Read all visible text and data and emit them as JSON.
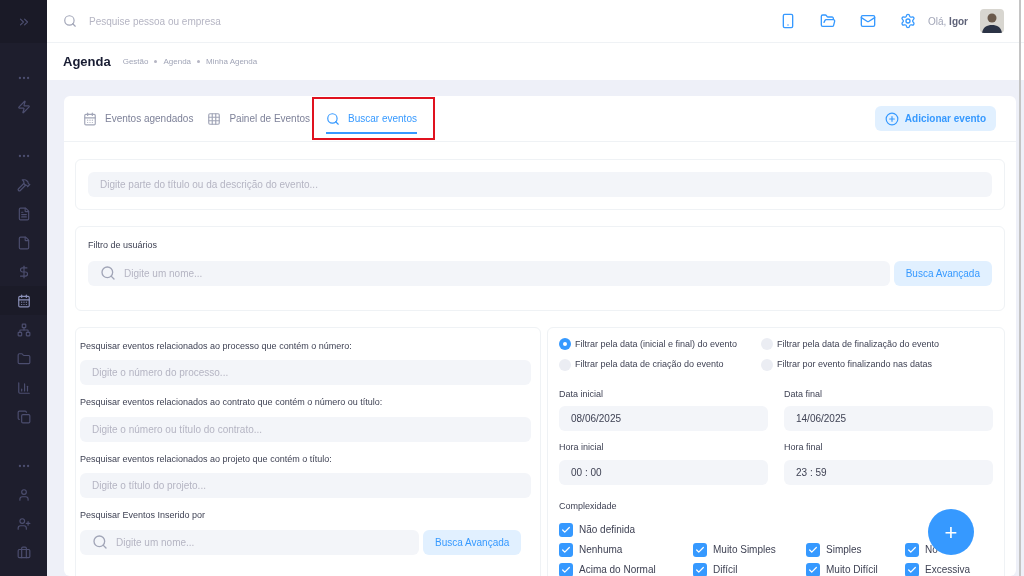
{
  "sidebar": {
    "items": [
      {
        "selected": false
      },
      {
        "selected": false
      },
      {
        "selected": false
      },
      {
        "selected": false
      },
      {
        "selected": false
      },
      {
        "selected": false
      },
      {
        "selected": false
      },
      {
        "selected": false
      },
      {
        "selected": true
      },
      {
        "selected": false
      },
      {
        "selected": false
      },
      {
        "selected": false
      },
      {
        "selected": false
      },
      {
        "selected": false
      },
      {
        "selected": false
      },
      {
        "selected": false
      },
      {
        "selected": false
      }
    ]
  },
  "topbar": {
    "search": {
      "placeholder": "Pesquise pessoa ou empresa"
    },
    "greeting": "Olá, **Igor**"
  },
  "page": {
    "title": "Agenda",
    "breadcrumb": [
      "Gestão",
      "Agenda",
      "Minha Agenda"
    ]
  },
  "tabs": [
    {
      "label": "Eventos agendados",
      "selected": false
    },
    {
      "label": "Painel de Eventos",
      "selected": false
    },
    {
      "label": "Buscar eventos",
      "selected": true
    }
  ],
  "add_button": "Adicionar evento",
  "text_search": {
    "placeholder": "Digite parte do título ou da descrição do evento..."
  },
  "user_filter": {
    "label": "Filtro de usuários",
    "placeholder": "Digite um nome...",
    "button": "Busca Avançada"
  },
  "left_fields": [
    {
      "label": "Pesquisar eventos relacionados ao processo que contém o número:",
      "placeholder": "Digite o número do processo..."
    },
    {
      "label": "Pesquisar eventos relacionados ao contrato que contém o número ou título:",
      "placeholder": "Digite o número ou título do contrato..."
    },
    {
      "label": "Pesquisar eventos relacionados ao projeto que contém o título:",
      "placeholder": "Digite o título do projeto..."
    }
  ],
  "inserted_by": {
    "label": "Pesquisar Eventos Inserido por",
    "placeholder": "Digite um nome...",
    "button": "Busca Avançada"
  },
  "date_modes": [
    {
      "label": "Filtrar pela data (inicial e final) do evento",
      "selected": true
    },
    {
      "label": "Filtrar pela data de finalização do evento",
      "selected": false
    },
    {
      "label": "Filtrar pela data de criação do evento",
      "selected": false
    },
    {
      "label": "Filtrar por evento finalizando nas datas",
      "selected": false
    }
  ],
  "date_fields": [
    {
      "label": "Data inicial",
      "value": "08/06/2025"
    },
    {
      "label": "Data final",
      "value": "14/06/2025"
    },
    {
      "label": "Hora inicial",
      "value": "00 : 00"
    },
    {
      "label": "Hora final",
      "value": "23 : 59"
    }
  ],
  "complexity": {
    "label": "Complexidade",
    "options": [
      {
        "label": "Não definida",
        "checked": true
      },
      {
        "label": "Nenhuma",
        "checked": true
      },
      {
        "label": "Muito Simples",
        "checked": true
      },
      {
        "label": "Simples",
        "checked": true
      },
      {
        "label": "No",
        "checked": true
      },
      {
        "label": "Acima do Normal",
        "checked": true
      },
      {
        "label": "Difícil",
        "checked": true
      },
      {
        "label": "Muito Difícil",
        "checked": true
      },
      {
        "label": "Excessiva",
        "checked": true
      }
    ]
  },
  "fab": "+"
}
